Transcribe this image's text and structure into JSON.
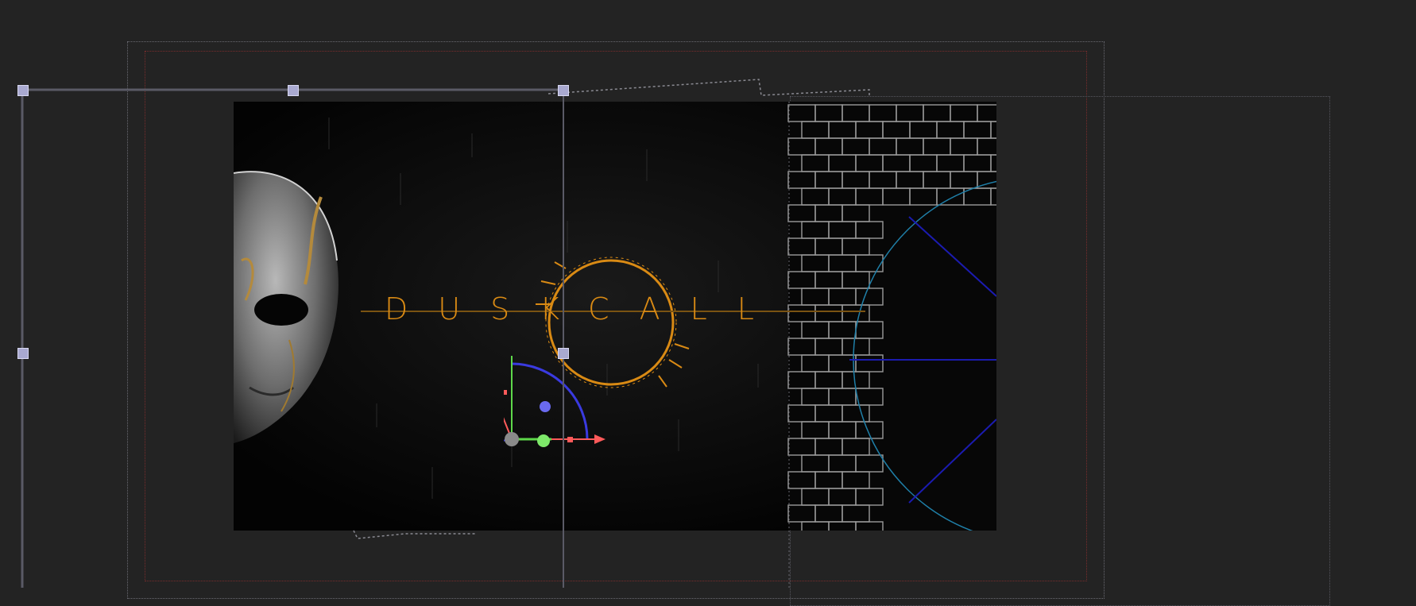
{
  "scene": {
    "title_text": "DUSKCALL"
  },
  "icons": {
    "mask": "mask-face-icon",
    "logo_ring": "sun-ring-icon",
    "brick_wall": "brick-wall-icon",
    "wireframe_circle": "wireframe-circle-icon",
    "gizmo": "transform-gizmo-icon"
  },
  "colors": {
    "canvas_bg": "#232323",
    "render_bg": "#050505",
    "title": "#d98a14",
    "gizmo_x": "#ff5a5a",
    "gizmo_y": "#5ed84a",
    "gizmo_z": "#3a3ae0",
    "circle_outline": "#1f7fa8",
    "handle": "#a9a9d0"
  }
}
